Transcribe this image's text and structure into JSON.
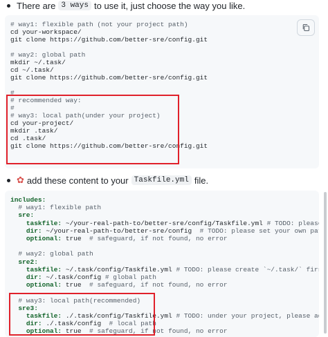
{
  "bullet1": {
    "prefix": "There are",
    "code": "3 ways",
    "suffix": "to use it, just choose the way you like."
  },
  "block1": {
    "copy_icon": "copy-icon",
    "lines": [
      "# way1: flexible path (not your project path)",
      "cd your-workspace/",
      "git clone https://github.com/better-sre/config.git",
      "",
      "# way2: global path",
      "mkdir ~/.task/",
      "cd ~/.task/",
      "git clone https://github.com/better-sre/config.git",
      "",
      "#",
      "# recommended way:",
      "#",
      "# way3: local path(under your project)",
      "cd your-project/",
      "mkdir .task/",
      "cd .task/",
      "git clone https://github.com/better-sre/config.git"
    ]
  },
  "bullet2": {
    "icon": "sparkle-icon",
    "prefix": "add these content to your",
    "code": "Taskfile.yml",
    "suffix": "file."
  },
  "block2": {
    "lines": [
      "includes:",
      "  # way1: flexible path",
      "  sre:",
      "    taskfile: ~/your-real-path-to/better-sre/config/Taskfile.yml # TODO: please set your own path to",
      "    dir: ~/your-real-path-to/better-sre/config  # TODO: please set your own path to the config dir",
      "    optional: true  # safeguard, if not found, no error",
      "",
      "  # way2: global path",
      "  sre2:",
      "    taskfile: ~/.task/config/Taskfile.yml # TODO: please create `~/.task/` first before use",
      "    dir: ~/.task/config # global path",
      "    optional: true  # safeguard, if not found, no error",
      "",
      "  # way3: local path(recommended)",
      "  sre3:",
      "    taskfile: ./.task/config/Taskfile.yml # TODO: under your project, please add `.task/` to your `",
      "    dir: ./.task/config  # local path",
      "    optional: true  # safeguard, if not found, no error"
    ]
  },
  "colors": {
    "highlight": "#e0202a",
    "code_bg": "#f6f8fa"
  }
}
